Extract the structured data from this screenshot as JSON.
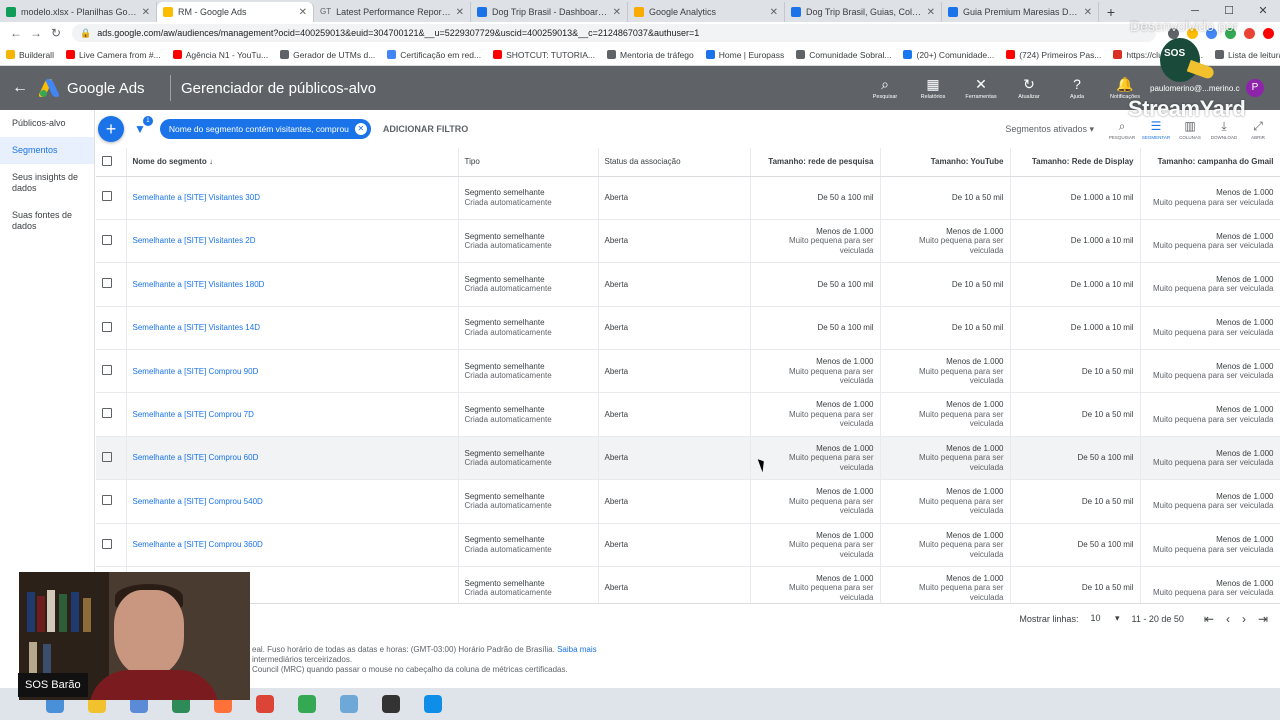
{
  "browser": {
    "tabs": [
      {
        "label": "modelo.xlsx - Planilhas Google",
        "color": "#0f9d58",
        "active": false
      },
      {
        "label": "RM - Google Ads",
        "color": "#fbbc04",
        "active": true
      },
      {
        "label": "Latest Performance Report for t",
        "color": "#5f6368",
        "active": false
      },
      {
        "label": "Dog Trip Brasil - Dashboard - Go",
        "color": "#1a73e8",
        "active": false
      },
      {
        "label": "Google Analytics",
        "color": "#f9ab00",
        "active": false
      },
      {
        "label": "Dog Trip Brasil, Guias, Coleiras e",
        "color": "#1a73e8",
        "active": false
      },
      {
        "label": "Guia Premium Maresias Dog Tri",
        "color": "#1a73e8",
        "active": false
      }
    ],
    "tab_prefixes": [
      "",
      "",
      "GT",
      "",
      "",
      "",
      ""
    ],
    "url": "ads.google.com/aw/audiences/management?ocid=400259013&euid=304700121&__u=5229307729&uscid=400259013&__c=2124867037&authuser=1",
    "bookmarks": [
      {
        "label": "Builderall",
        "color": "#f4b400"
      },
      {
        "label": "Live Camera from #...",
        "color": "#ff0000"
      },
      {
        "label": "Agência N1 - YouTu...",
        "color": "#ff0000"
      },
      {
        "label": "Gerador de UTMs d...",
        "color": "#5f6368"
      },
      {
        "label": "Certificação em red...",
        "color": "#4285f4"
      },
      {
        "label": "SHOTCUT: TUTORIA...",
        "color": "#ff0000"
      },
      {
        "label": "Mentoria de tráfego",
        "color": "#5f6368"
      },
      {
        "label": "Home | Europass",
        "color": "#1a73e8"
      },
      {
        "label": "Comunidade Sobral...",
        "color": "#5f6368"
      },
      {
        "label": "(20+) Comunidade...",
        "color": "#1877f2"
      },
      {
        "label": "(724) Primeiros Pas...",
        "color": "#ff0000"
      },
      {
        "label": "https://club.segred...",
        "color": "#d93025"
      },
      {
        "label": "Lista de leitura",
        "color": "#5f6368"
      }
    ]
  },
  "header": {
    "product": "Google Ads",
    "title": "Gerenciador de públicos-alvo",
    "icons": [
      {
        "name": "search-icon",
        "glyph": "⌕",
        "label": "Pesquisar"
      },
      {
        "name": "reports-icon",
        "glyph": "▦",
        "label": "Relatórios"
      },
      {
        "name": "tools-icon",
        "glyph": "✕",
        "label": "Ferramentas"
      },
      {
        "name": "refresh-icon",
        "glyph": "↻",
        "label": "Atualizar"
      },
      {
        "name": "help-icon",
        "glyph": "?",
        "label": "Ajuda"
      },
      {
        "name": "notifications-icon",
        "glyph": "🔔",
        "label": "Notificações"
      }
    ],
    "account": "paulomerino@...merino.com...",
    "avatar": "P"
  },
  "sidenav": [
    {
      "label": "Públicos-alvo",
      "active": false
    },
    {
      "label": "Segmentos",
      "active": true
    },
    {
      "label": "Seus insights de dados",
      "active": false
    },
    {
      "label": "Suas fontes de dados",
      "active": false
    }
  ],
  "filterbar": {
    "filter_count": "1",
    "chip": "Nome do segmento contém visitantes, comprou",
    "add_filter": "ADICIONAR FILTRO",
    "segment_select": "Segmentos ativados",
    "tools": [
      {
        "name": "search-icon",
        "glyph": "⌕",
        "label": "PESQUISAR",
        "active": false
      },
      {
        "name": "segment-icon",
        "glyph": "☰",
        "label": "SEGMENTAR",
        "active": true
      },
      {
        "name": "columns-icon",
        "glyph": "▥",
        "label": "COLUNAS",
        "active": false
      },
      {
        "name": "download-icon",
        "glyph": "⤓",
        "label": "DOWNLOAD",
        "active": false
      },
      {
        "name": "expand-icon",
        "glyph": "⤢",
        "label": "ABRIR",
        "active": false
      }
    ]
  },
  "table": {
    "headers": {
      "name": "Nome do segmento",
      "type": "Tipo",
      "status": "Status da associação",
      "search": "Tamanho: rede de pesquisa",
      "youtube": "Tamanho: YouTube",
      "display": "Tamanho: Rede de Display",
      "gmail": "Tamanho: campanha do Gmail"
    },
    "rows": [
      {
        "name": "Semelhante a [SITE] Visitantes 30D",
        "type": "Segmento semelhante",
        "type_sub": "Criada automaticamente",
        "status": "Aberta",
        "search": "De 50 a 100 mil",
        "search_sub": "",
        "youtube": "De 10 a 50 mil",
        "youtube_sub": "",
        "display": "De 1.000 a 10 mil",
        "display_sub": "",
        "gmail": "Menos de 1.000",
        "gmail_sub": "Muito pequena para ser veiculada"
      },
      {
        "name": "Semelhante a [SITE] Visitantes 2D",
        "type": "Segmento semelhante",
        "type_sub": "Criada automaticamente",
        "status": "Aberta",
        "search": "Menos de 1.000",
        "search_sub": "Muito pequena para ser veiculada",
        "youtube": "Menos de 1.000",
        "youtube_sub": "Muito pequena para ser veiculada",
        "display": "De 1.000 a 10 mil",
        "display_sub": "",
        "gmail": "Menos de 1.000",
        "gmail_sub": "Muito pequena para ser veiculada"
      },
      {
        "name": "Semelhante a [SITE] Visitantes 180D",
        "type": "Segmento semelhante",
        "type_sub": "Criada automaticamente",
        "status": "Aberta",
        "search": "De 50 a 100 mil",
        "search_sub": "",
        "youtube": "De 10 a 50 mil",
        "youtube_sub": "",
        "display": "De 1.000 a 10 mil",
        "display_sub": "",
        "gmail": "Menos de 1.000",
        "gmail_sub": "Muito pequena para ser veiculada"
      },
      {
        "name": "Semelhante a [SITE] Visitantes 14D",
        "type": "Segmento semelhante",
        "type_sub": "Criada automaticamente",
        "status": "Aberta",
        "search": "De 50 a 100 mil",
        "search_sub": "",
        "youtube": "De 10 a 50 mil",
        "youtube_sub": "",
        "display": "De 1.000 a 10 mil",
        "display_sub": "",
        "gmail": "Menos de 1.000",
        "gmail_sub": "Muito pequena para ser veiculada"
      },
      {
        "name": "Semelhante a [SITE] Comprou 90D",
        "type": "Segmento semelhante",
        "type_sub": "Criada automaticamente",
        "status": "Aberta",
        "search": "Menos de 1.000",
        "search_sub": "Muito pequena para ser veiculada",
        "youtube": "Menos de 1.000",
        "youtube_sub": "Muito pequena para ser veiculada",
        "display": "De 10 a 50 mil",
        "display_sub": "",
        "gmail": "Menos de 1.000",
        "gmail_sub": "Muito pequena para ser veiculada"
      },
      {
        "name": "Semelhante a [SITE] Comprou 7D",
        "type": "Segmento semelhante",
        "type_sub": "Criada automaticamente",
        "status": "Aberta",
        "search": "Menos de 1.000",
        "search_sub": "Muito pequena para ser veiculada",
        "youtube": "Menos de 1.000",
        "youtube_sub": "Muito pequena para ser veiculada",
        "display": "De 10 a 50 mil",
        "display_sub": "",
        "gmail": "Menos de 1.000",
        "gmail_sub": "Muito pequena para ser veiculada"
      },
      {
        "name": "Semelhante a [SITE] Comprou 60D",
        "type": "Segmento semelhante",
        "type_sub": "Criada automaticamente",
        "status": "Aberta",
        "search": "Menos de 1.000",
        "search_sub": "Muito pequena para ser veiculada",
        "youtube": "Menos de 1.000",
        "youtube_sub": "Muito pequena para ser veiculada",
        "display": "De 50 a 100 mil",
        "display_sub": "",
        "gmail": "Menos de 1.000",
        "gmail_sub": "Muito pequena para ser veiculada"
      },
      {
        "name": "Semelhante a [SITE] Comprou 540D",
        "type": "Segmento semelhante",
        "type_sub": "Criada automaticamente",
        "status": "Aberta",
        "search": "Menos de 1.000",
        "search_sub": "Muito pequena para ser veiculada",
        "youtube": "Menos de 1.000",
        "youtube_sub": "Muito pequena para ser veiculada",
        "display": "De 10 a 50 mil",
        "display_sub": "",
        "gmail": "Menos de 1.000",
        "gmail_sub": "Muito pequena para ser veiculada"
      },
      {
        "name": "Semelhante a [SITE] Comprou 360D",
        "type": "Segmento semelhante",
        "type_sub": "Criada automaticamente",
        "status": "Aberta",
        "search": "Menos de 1.000",
        "search_sub": "Muito pequena para ser veiculada",
        "youtube": "Menos de 1.000",
        "youtube_sub": "Muito pequena para ser veiculada",
        "display": "De 50 a 100 mil",
        "display_sub": "",
        "gmail": "Menos de 1.000",
        "gmail_sub": "Muito pequena para ser veiculada"
      },
      {
        "name": "D",
        "type": "Segmento semelhante",
        "type_sub": "Criada automaticamente",
        "status": "Aberta",
        "search": "Menos de 1.000",
        "search_sub": "Muito pequena para ser veiculada",
        "youtube": "Menos de 1.000",
        "youtube_sub": "Muito pequena para ser veiculada",
        "display": "De 10 a 50 mil",
        "display_sub": "",
        "gmail": "Menos de 1.000",
        "gmail_sub": "Muito pequena para ser veiculada"
      }
    ]
  },
  "pager": {
    "rows_label": "Mostrar linhas:",
    "rows_value": "10",
    "range": "11 - 20 de 50"
  },
  "footer": {
    "line1": "eal. Fuso horário de todas as datas e horas: (GMT-03:00) Horário Padrão de Brasília.",
    "link": "Saiba mais",
    "line2": "intermediários terceirizados.",
    "line3": "Council (MRC) quando passar o mouse no cabeçalho da coluna de métricas certificadas."
  },
  "overlay": {
    "presenter": "SOS Barão",
    "watermark": "StreamYard",
    "desenvolvido": "Desenvolvido por",
    "logo_text": "SOS"
  },
  "taskbar": [
    {
      "name": "app-1-icon",
      "color": "#4a90d9"
    },
    {
      "name": "file-explorer-icon",
      "color": "#f2c12e"
    },
    {
      "name": "app-3-icon",
      "color": "#5b8bd6"
    },
    {
      "name": "app-4-icon",
      "color": "#2e8b57"
    },
    {
      "name": "firefox-icon",
      "color": "#ff7139"
    },
    {
      "name": "chrome-icon",
      "color": "#db4437"
    },
    {
      "name": "google-drive-icon",
      "color": "#34a853"
    },
    {
      "name": "app-8-icon",
      "color": "#6ea8d6"
    },
    {
      "name": "app-9-icon",
      "color": "#333333"
    },
    {
      "name": "teamviewer-icon",
      "color": "#0e8ee9"
    }
  ]
}
